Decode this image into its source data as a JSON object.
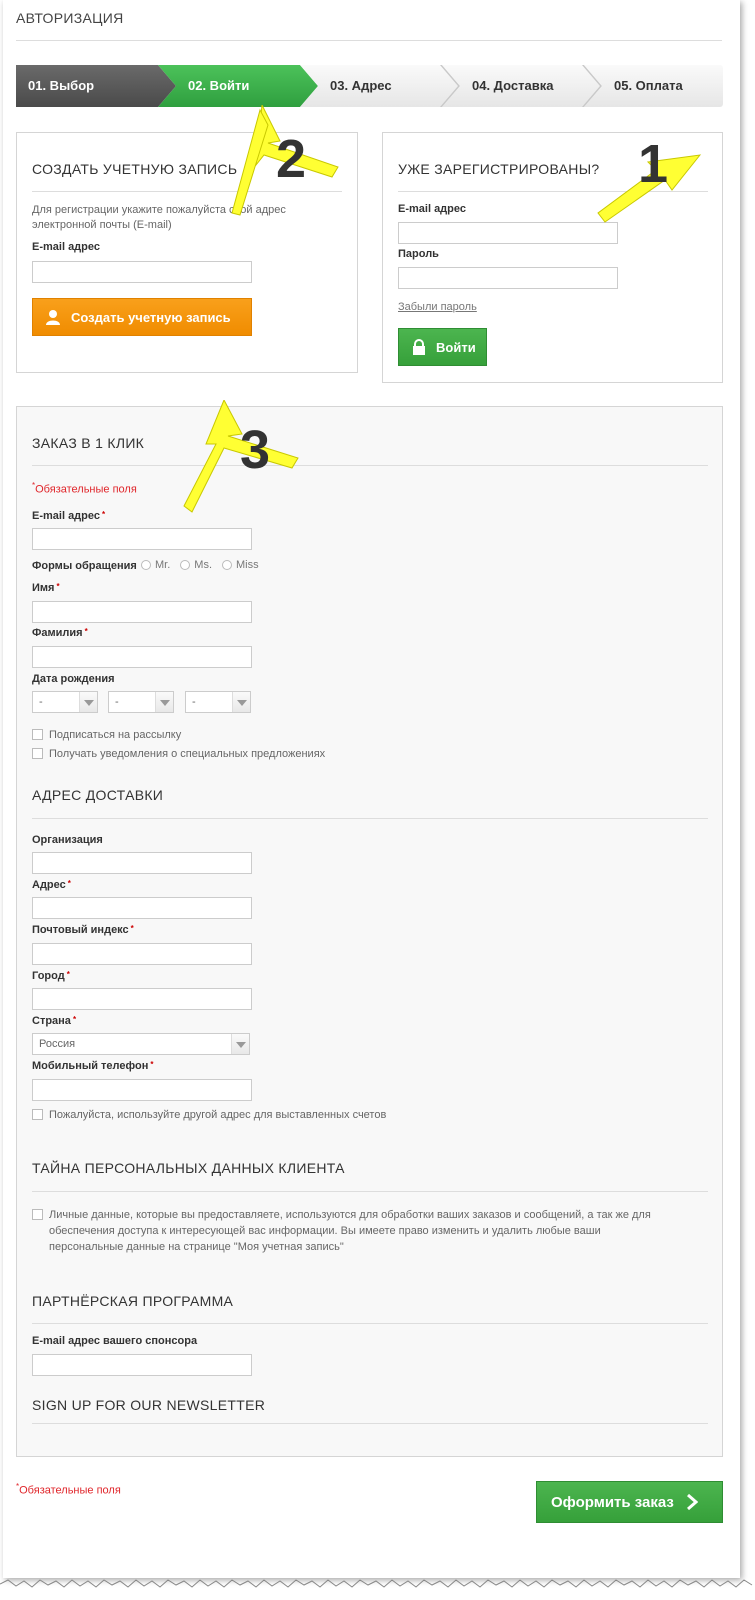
{
  "page": {
    "title": "АВТОРИЗАЦИЯ"
  },
  "steps": [
    {
      "label": "01. Выбор",
      "state": "done"
    },
    {
      "label": "02. Войти",
      "state": "active"
    },
    {
      "label": "03. Адрес",
      "state": "todo"
    },
    {
      "label": "04. Доставка",
      "state": "todo"
    },
    {
      "label": "05. Оплата",
      "state": "todo"
    }
  ],
  "create_account": {
    "title": "СОЗДАТЬ УЧЕТНУЮ ЗАПИСЬ",
    "hint": "Для регистрации укажите пожалуйста свой адрес электронной почты (E-mail)",
    "email_label": "E-mail адрес",
    "button_label": "Создать учетную запись",
    "button_color": "#f59300"
  },
  "login": {
    "title": "УЖЕ ЗАРЕГИСТРИРОВАНЫ?",
    "email_label": "E-mail адрес",
    "password_label": "Пароль",
    "forgot_link": "Забыли пароль",
    "button_label": "Войти",
    "button_color": "#3aa83e"
  },
  "quick_order": {
    "title": "ЗАКАЗ В 1 КЛИК",
    "required_note": "Обязательные поля",
    "email_label": "E-mail адрес",
    "salutation_label": "Формы обращения",
    "salutation_options": [
      "Mr.",
      "Ms.",
      "Miss"
    ],
    "first_name_label": "Имя",
    "last_name_label": "Фамилия",
    "birthdate_label": "Дата рождения",
    "birth_day": "-",
    "birth_month": "-",
    "birth_year": "-",
    "newsletter_label": "Подписаться на рассылку",
    "offers_label": "Получать уведомления о специальных предложениях"
  },
  "delivery": {
    "title": "АДРЕС ДОСТАВКИ",
    "company_label": "Организация",
    "address_label": "Адрес",
    "zip_label": "Почтовый индекс",
    "city_label": "Город",
    "country_label": "Страна",
    "country_value": "Россия",
    "phone_label": "Мобильный телефон",
    "other_invoice_label": "Пожалуйста, используйте другой адрес для выставленных счетов"
  },
  "privacy": {
    "title": "ТАЙНА ПЕРСОНАЛЬНЫХ ДАННЫХ КЛИЕНТА",
    "text": "Личные данные, которые вы предоставляете, используются для обработки ваших заказов и сообщений, а так же для обеспечения доступа к интересующей вас информации. Вы имеете право изменить и удалить любые ваши персональные данные на странице \"Моя учетная запись\""
  },
  "partner": {
    "title": "ПАРТНЁРСКАЯ ПРОГРАММА",
    "sponsor_email_label": "E-mail адрес вашего спонсора"
  },
  "newsletter": {
    "title": "SIGN UP FOR OUR NEWSLETTER"
  },
  "footer": {
    "required_note": "Обязательные поля",
    "submit_label": "Оформить заказ",
    "submit_color": "#3aa83e"
  },
  "annotations": [
    "1",
    "2",
    "3"
  ],
  "annotation_color": "#ffff33",
  "icons": {
    "user": "user-icon",
    "lock": "lock-icon",
    "chevron": "chevron-right-icon"
  }
}
